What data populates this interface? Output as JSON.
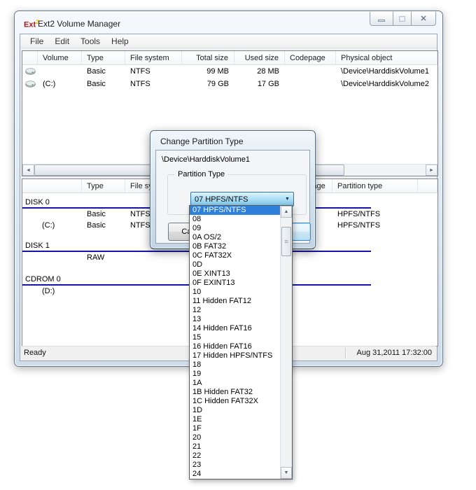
{
  "window": {
    "title": "Ext2 Volume Manager",
    "icon": {
      "text": "Ext",
      "sup": "2"
    },
    "menu": {
      "items": [
        "File",
        "Edit",
        "Tools",
        "Help"
      ]
    }
  },
  "icons": {
    "close": "✕",
    "combo_arrow": "▼",
    "scroll_up": "▲",
    "scroll_down": "▼",
    "scroll_left": "◄",
    "scroll_right": "►",
    "thumb_grip": "≡"
  },
  "volumes_table": {
    "columns": [
      "",
      "Volume",
      "Type",
      "File system",
      "Total size",
      "Used size",
      "Codepage",
      "Physical object"
    ],
    "rows": [
      {
        "volume": "",
        "type": "Basic",
        "filesystem": "NTFS",
        "total_size": "99 MB",
        "used_size": "28 MB",
        "codepage": "",
        "physical_object": "\\Device\\HarddiskVolume1"
      },
      {
        "volume": "(C:)",
        "type": "Basic",
        "filesystem": "NTFS",
        "total_size": "79 GB",
        "used_size": "17 GB",
        "codepage": "",
        "physical_object": "\\Device\\HarddiskVolume2"
      }
    ]
  },
  "disks_table": {
    "columns": [
      "",
      "Type",
      "File system",
      "",
      "Codepage",
      "Partition type"
    ],
    "groups": [
      {
        "name": "DISK 0",
        "rows": [
          {
            "volume": "",
            "type": "Basic",
            "filesystem": "NTFS",
            "partition_type": "HPFS/NTFS"
          },
          {
            "volume": "(C:)",
            "type": "Basic",
            "filesystem": "NTFS",
            "partition_type": "HPFS/NTFS"
          }
        ]
      },
      {
        "name": "DISK 1",
        "rows": [
          {
            "volume": "",
            "type": "RAW",
            "filesystem": "",
            "partition_type": ""
          }
        ]
      },
      {
        "name": "CDROM 0",
        "rows": [
          {
            "volume": "(D:)",
            "type": "",
            "filesystem": "",
            "partition_type": ""
          }
        ]
      }
    ]
  },
  "dialog": {
    "title": "Change Partition Type",
    "device_path": "\\Device\\HarddiskVolume1",
    "group_label": "Partition Type",
    "combobox": {
      "value": "07 HPFS/NTFS"
    },
    "buttons": {
      "cancel": "Cancel",
      "default": ""
    },
    "dropdown": {
      "selected_index": 0,
      "items": [
        "07 HPFS/NTFS",
        "08",
        "09",
        "0A OS/2",
        "0B FAT32",
        "0C FAT32X",
        "0D",
        "0E XINT13",
        "0F EXINT13",
        "10",
        "11 Hidden FAT12",
        "12",
        "13",
        "14 Hidden FAT16",
        "15",
        "16 Hidden FAT16",
        "17 Hidden HPFS/NTFS",
        "18",
        "19",
        "1A",
        "1B Hidden FAT32",
        "1C Hidden FAT32X",
        "1D",
        "1E",
        "1F",
        "20",
        "21",
        "22",
        "23",
        "24"
      ]
    }
  },
  "statusbar": {
    "status": "Ready",
    "datetime": "Aug 31,2011 17:32:00"
  }
}
